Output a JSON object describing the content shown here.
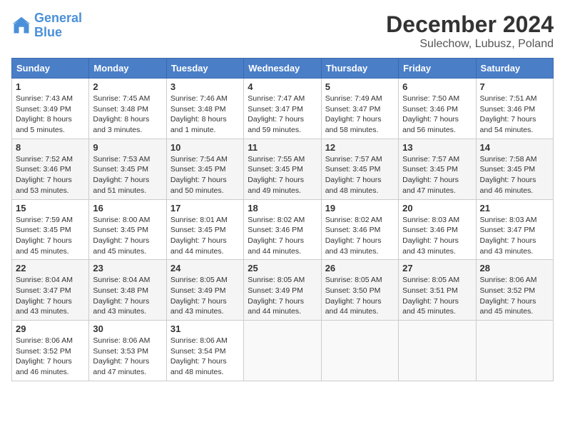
{
  "header": {
    "logo_line1": "General",
    "logo_line2": "Blue",
    "title": "December 2024",
    "subtitle": "Sulechow, Lubusz, Poland"
  },
  "days_of_week": [
    "Sunday",
    "Monday",
    "Tuesday",
    "Wednesday",
    "Thursday",
    "Friday",
    "Saturday"
  ],
  "weeks": [
    [
      {
        "day": 1,
        "info": "Sunrise: 7:43 AM\nSunset: 3:49 PM\nDaylight: 8 hours\nand 5 minutes."
      },
      {
        "day": 2,
        "info": "Sunrise: 7:45 AM\nSunset: 3:48 PM\nDaylight: 8 hours\nand 3 minutes."
      },
      {
        "day": 3,
        "info": "Sunrise: 7:46 AM\nSunset: 3:48 PM\nDaylight: 8 hours\nand 1 minute."
      },
      {
        "day": 4,
        "info": "Sunrise: 7:47 AM\nSunset: 3:47 PM\nDaylight: 7 hours\nand 59 minutes."
      },
      {
        "day": 5,
        "info": "Sunrise: 7:49 AM\nSunset: 3:47 PM\nDaylight: 7 hours\nand 58 minutes."
      },
      {
        "day": 6,
        "info": "Sunrise: 7:50 AM\nSunset: 3:46 PM\nDaylight: 7 hours\nand 56 minutes."
      },
      {
        "day": 7,
        "info": "Sunrise: 7:51 AM\nSunset: 3:46 PM\nDaylight: 7 hours\nand 54 minutes."
      }
    ],
    [
      {
        "day": 8,
        "info": "Sunrise: 7:52 AM\nSunset: 3:46 PM\nDaylight: 7 hours\nand 53 minutes."
      },
      {
        "day": 9,
        "info": "Sunrise: 7:53 AM\nSunset: 3:45 PM\nDaylight: 7 hours\nand 51 minutes."
      },
      {
        "day": 10,
        "info": "Sunrise: 7:54 AM\nSunset: 3:45 PM\nDaylight: 7 hours\nand 50 minutes."
      },
      {
        "day": 11,
        "info": "Sunrise: 7:55 AM\nSunset: 3:45 PM\nDaylight: 7 hours\nand 49 minutes."
      },
      {
        "day": 12,
        "info": "Sunrise: 7:57 AM\nSunset: 3:45 PM\nDaylight: 7 hours\nand 48 minutes."
      },
      {
        "day": 13,
        "info": "Sunrise: 7:57 AM\nSunset: 3:45 PM\nDaylight: 7 hours\nand 47 minutes."
      },
      {
        "day": 14,
        "info": "Sunrise: 7:58 AM\nSunset: 3:45 PM\nDaylight: 7 hours\nand 46 minutes."
      }
    ],
    [
      {
        "day": 15,
        "info": "Sunrise: 7:59 AM\nSunset: 3:45 PM\nDaylight: 7 hours\nand 45 minutes."
      },
      {
        "day": 16,
        "info": "Sunrise: 8:00 AM\nSunset: 3:45 PM\nDaylight: 7 hours\nand 45 minutes."
      },
      {
        "day": 17,
        "info": "Sunrise: 8:01 AM\nSunset: 3:45 PM\nDaylight: 7 hours\nand 44 minutes."
      },
      {
        "day": 18,
        "info": "Sunrise: 8:02 AM\nSunset: 3:46 PM\nDaylight: 7 hours\nand 44 minutes."
      },
      {
        "day": 19,
        "info": "Sunrise: 8:02 AM\nSunset: 3:46 PM\nDaylight: 7 hours\nand 43 minutes."
      },
      {
        "day": 20,
        "info": "Sunrise: 8:03 AM\nSunset: 3:46 PM\nDaylight: 7 hours\nand 43 minutes."
      },
      {
        "day": 21,
        "info": "Sunrise: 8:03 AM\nSunset: 3:47 PM\nDaylight: 7 hours\nand 43 minutes."
      }
    ],
    [
      {
        "day": 22,
        "info": "Sunrise: 8:04 AM\nSunset: 3:47 PM\nDaylight: 7 hours\nand 43 minutes."
      },
      {
        "day": 23,
        "info": "Sunrise: 8:04 AM\nSunset: 3:48 PM\nDaylight: 7 hours\nand 43 minutes."
      },
      {
        "day": 24,
        "info": "Sunrise: 8:05 AM\nSunset: 3:49 PM\nDaylight: 7 hours\nand 43 minutes."
      },
      {
        "day": 25,
        "info": "Sunrise: 8:05 AM\nSunset: 3:49 PM\nDaylight: 7 hours\nand 44 minutes."
      },
      {
        "day": 26,
        "info": "Sunrise: 8:05 AM\nSunset: 3:50 PM\nDaylight: 7 hours\nand 44 minutes."
      },
      {
        "day": 27,
        "info": "Sunrise: 8:05 AM\nSunset: 3:51 PM\nDaylight: 7 hours\nand 45 minutes."
      },
      {
        "day": 28,
        "info": "Sunrise: 8:06 AM\nSunset: 3:52 PM\nDaylight: 7 hours\nand 45 minutes."
      }
    ],
    [
      {
        "day": 29,
        "info": "Sunrise: 8:06 AM\nSunset: 3:52 PM\nDaylight: 7 hours\nand 46 minutes."
      },
      {
        "day": 30,
        "info": "Sunrise: 8:06 AM\nSunset: 3:53 PM\nDaylight: 7 hours\nand 47 minutes."
      },
      {
        "day": 31,
        "info": "Sunrise: 8:06 AM\nSunset: 3:54 PM\nDaylight: 7 hours\nand 48 minutes."
      },
      null,
      null,
      null,
      null
    ]
  ]
}
